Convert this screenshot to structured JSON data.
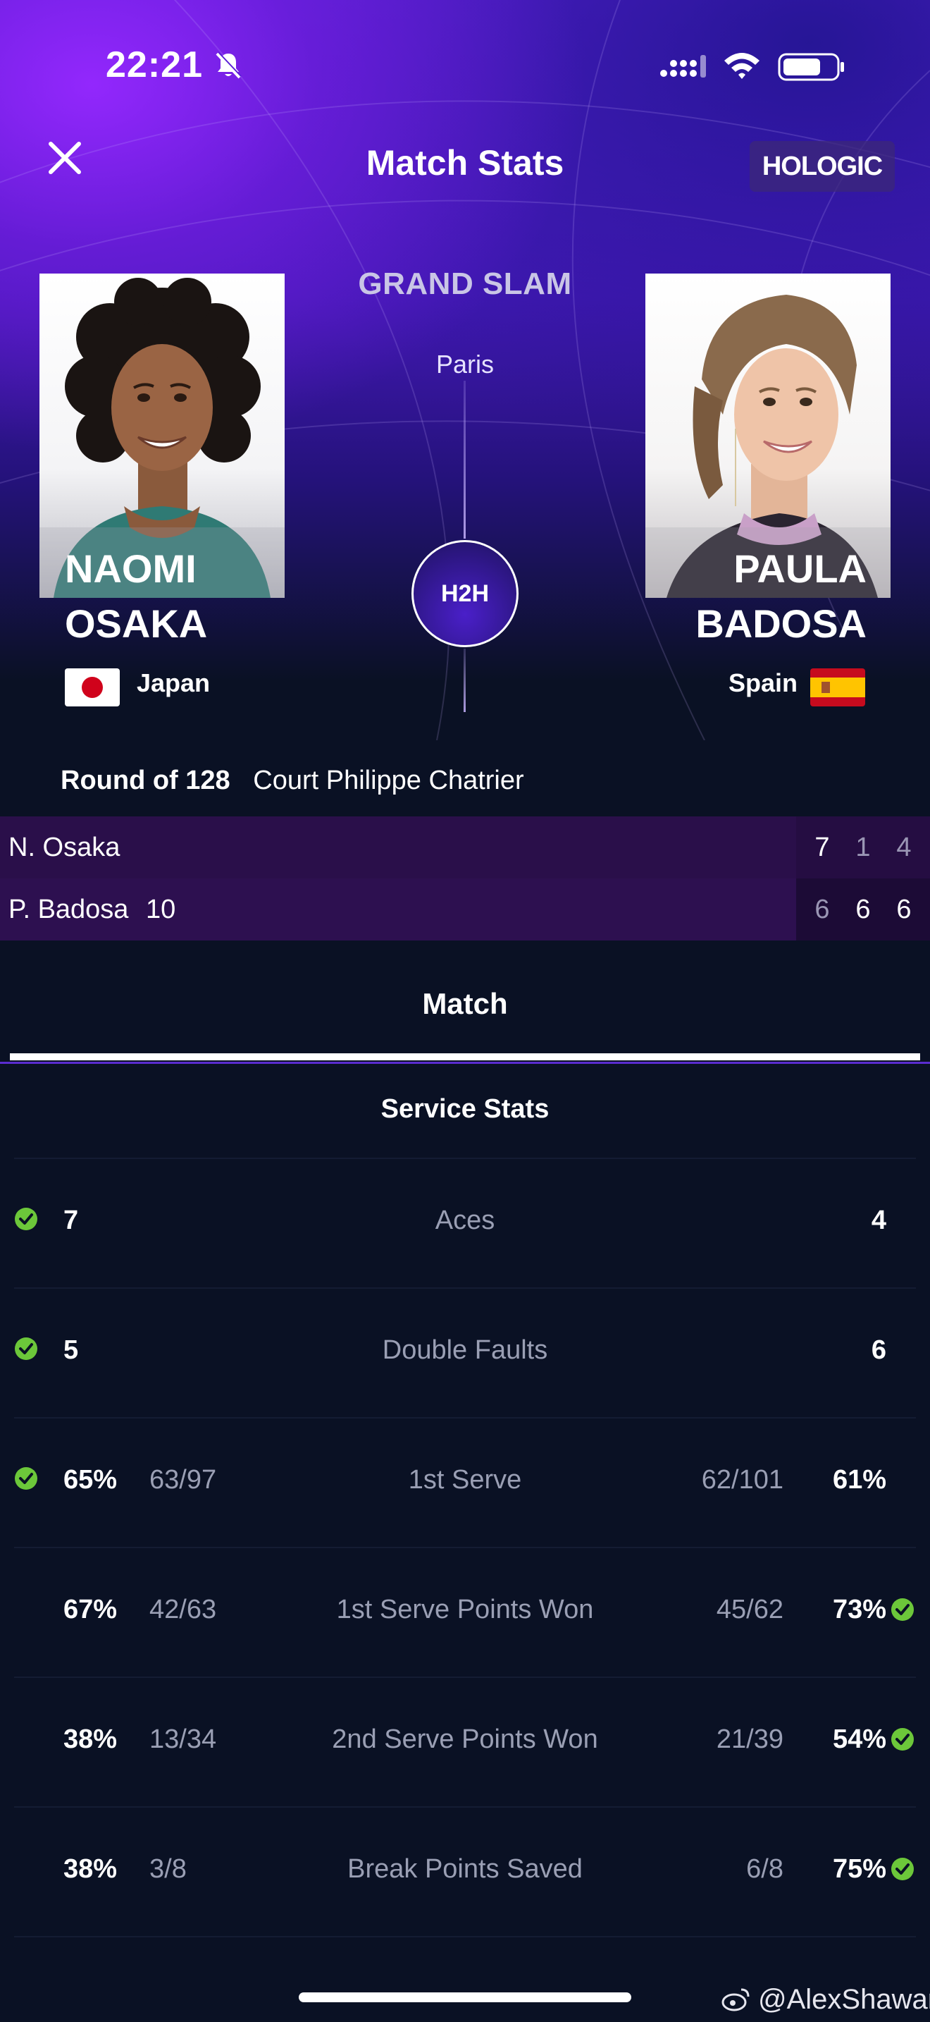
{
  "status_bar": {
    "time": "22:21",
    "icons": [
      "bell-muted-icon",
      "signal-icon",
      "wifi-icon",
      "battery-icon"
    ]
  },
  "header": {
    "title": "Match Stats",
    "sponsor": "HOLOGIC",
    "close_icon": "close-icon"
  },
  "tournament": {
    "category": "GRAND SLAM",
    "city": "Paris",
    "h2h_label": "H2H"
  },
  "player1": {
    "first": "NAOMI",
    "last": "OSAKA",
    "country": "Japan",
    "short_name": "N. Osaka",
    "seed": "",
    "sets": [
      "7",
      "1",
      "4"
    ],
    "sets_won": [
      true,
      false,
      false
    ]
  },
  "player2": {
    "first": "PAULA",
    "last": "BADOSA",
    "country": "Spain",
    "short_name": "P. Badosa",
    "seed": "10",
    "sets": [
      "6",
      "6",
      "6"
    ],
    "sets_won": [
      false,
      true,
      true
    ]
  },
  "match_info": {
    "round": "Round of 128",
    "court": "Court Philippe Chatrier"
  },
  "tabs": {
    "active": "Match"
  },
  "stats": {
    "section_title": "Service Stats",
    "rows": [
      {
        "label": "Aces",
        "p1_value": "7",
        "p1_fraction": "",
        "p2_fraction": "",
        "p2_value": "4",
        "leader": "p1"
      },
      {
        "label": "Double Faults",
        "p1_value": "5",
        "p1_fraction": "",
        "p2_fraction": "",
        "p2_value": "6",
        "leader": "p1"
      },
      {
        "label": "1st Serve",
        "p1_value": "65%",
        "p1_fraction": "63/97",
        "p2_fraction": "62/101",
        "p2_value": "61%",
        "leader": "p1"
      },
      {
        "label": "1st Serve Points Won",
        "p1_value": "67%",
        "p1_fraction": "42/63",
        "p2_fraction": "45/62",
        "p2_value": "73%",
        "leader": "p2"
      },
      {
        "label": "2nd Serve Points Won",
        "p1_value": "38%",
        "p1_fraction": "13/34",
        "p2_fraction": "21/39",
        "p2_value": "54%",
        "leader": "p2"
      },
      {
        "label": "Break Points Saved",
        "p1_value": "38%",
        "p1_fraction": "3/8",
        "p2_fraction": "6/8",
        "p2_value": "75%",
        "leader": "p2"
      }
    ]
  },
  "watermark": "@AlexShawan",
  "colors": {
    "accent_purple": "#5a1fd6",
    "background": "#0a1124",
    "check_green": "#6cc73a"
  }
}
